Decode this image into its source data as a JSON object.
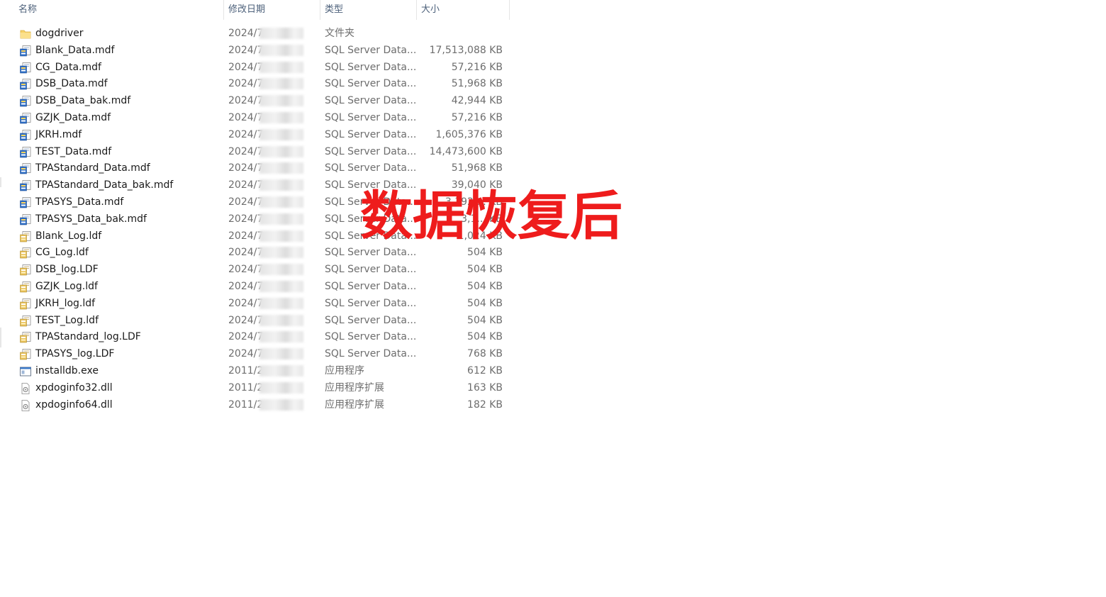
{
  "columns": {
    "name": "名称",
    "date": "修改日期",
    "type": "类型",
    "size": "大小"
  },
  "icons": {
    "folder": "folder-icon",
    "mdf": "sql-data-file-icon",
    "ldf": "sql-log-file-icon",
    "exe": "application-icon",
    "dll": "dll-icon"
  },
  "files": [
    {
      "name": "dogdriver",
      "date": "2024/7",
      "type": "文件夹",
      "size": "",
      "icon": "folder"
    },
    {
      "name": "Blank_Data.mdf",
      "date": "2024/7",
      "type": "SQL Server Data...",
      "size": "17,513,088 KB",
      "icon": "mdf"
    },
    {
      "name": "CG_Data.mdf",
      "date": "2024/7",
      "type": "SQL Server Data...",
      "size": "57,216 KB",
      "icon": "mdf"
    },
    {
      "name": "DSB_Data.mdf",
      "date": "2024/7",
      "type": "SQL Server Data...",
      "size": "51,968 KB",
      "icon": "mdf"
    },
    {
      "name": "DSB_Data_bak.mdf",
      "date": "2024/7",
      "type": "SQL Server Data...",
      "size": "42,944 KB",
      "icon": "mdf"
    },
    {
      "name": "GZJK_Data.mdf",
      "date": "2024/7",
      "type": "SQL Server Data...",
      "size": "57,216 KB",
      "icon": "mdf"
    },
    {
      "name": "JKRH.mdf",
      "date": "2024/7",
      "type": "SQL Server Data...",
      "size": "1,605,376 KB",
      "icon": "mdf"
    },
    {
      "name": "TEST_Data.mdf",
      "date": "2024/7",
      "type": "SQL Server Data...",
      "size": "14,473,600 KB",
      "icon": "mdf"
    },
    {
      "name": "TPAStandard_Data.mdf",
      "date": "2024/7",
      "type": "SQL Server Data...",
      "size": "51,968 KB",
      "icon": "mdf"
    },
    {
      "name": "TPAStandard_Data_bak.mdf",
      "date": "2024/7",
      "type": "SQL Server Data...",
      "size": "39,040 KB",
      "icon": "mdf"
    },
    {
      "name": "TPASYS_Data.mdf",
      "date": "2024/7",
      "type": "SQL Server Data...",
      "size": "3,392,... KB",
      "icon": "mdf"
    },
    {
      "name": "TPASYS_Data_bak.mdf",
      "date": "2024/7",
      "type": "SQL Server Data...",
      "size": "3,1... KB",
      "icon": "mdf"
    },
    {
      "name": "Blank_Log.ldf",
      "date": "2024/7",
      "type": "SQL Server Data...",
      "size": "1,024 KB",
      "icon": "ldf"
    },
    {
      "name": "CG_Log.ldf",
      "date": "2024/7",
      "type": "SQL Server Data...",
      "size": "504 KB",
      "icon": "ldf"
    },
    {
      "name": "DSB_log.LDF",
      "date": "2024/7",
      "type": "SQL Server Data...",
      "size": "504 KB",
      "icon": "ldf"
    },
    {
      "name": "GZJK_Log.ldf",
      "date": "2024/7",
      "type": "SQL Server Data...",
      "size": "504 KB",
      "icon": "ldf"
    },
    {
      "name": "JKRH_log.ldf",
      "date": "2024/7",
      "type": "SQL Server Data...",
      "size": "504 KB",
      "icon": "ldf"
    },
    {
      "name": "TEST_Log.ldf",
      "date": "2024/7",
      "type": "SQL Server Data...",
      "size": "504 KB",
      "icon": "ldf"
    },
    {
      "name": "TPAStandard_log.LDF",
      "date": "2024/7",
      "type": "SQL Server Data...",
      "size": "504 KB",
      "icon": "ldf"
    },
    {
      "name": "TPASYS_log.LDF",
      "date": "2024/7",
      "type": "SQL Server Data...",
      "size": "768 KB",
      "icon": "ldf"
    },
    {
      "name": "installdb.exe",
      "date": "2011/2",
      "type": "应用程序",
      "size": "612 KB",
      "icon": "exe"
    },
    {
      "name": "xpdoginfo32.dll",
      "date": "2011/2",
      "type": "应用程序扩展",
      "size": "163 KB",
      "icon": "dll"
    },
    {
      "name": "xpdoginfo64.dll",
      "date": "2011/2",
      "type": "应用程序扩展",
      "size": "182 KB",
      "icon": "dll"
    }
  ],
  "overlay_text": "数据恢复后",
  "colors": {
    "overlay": "#ee1c1c",
    "header_text": "#4c607a",
    "secondary_text": "#6d6d6d",
    "folder": "#f7d36b"
  }
}
